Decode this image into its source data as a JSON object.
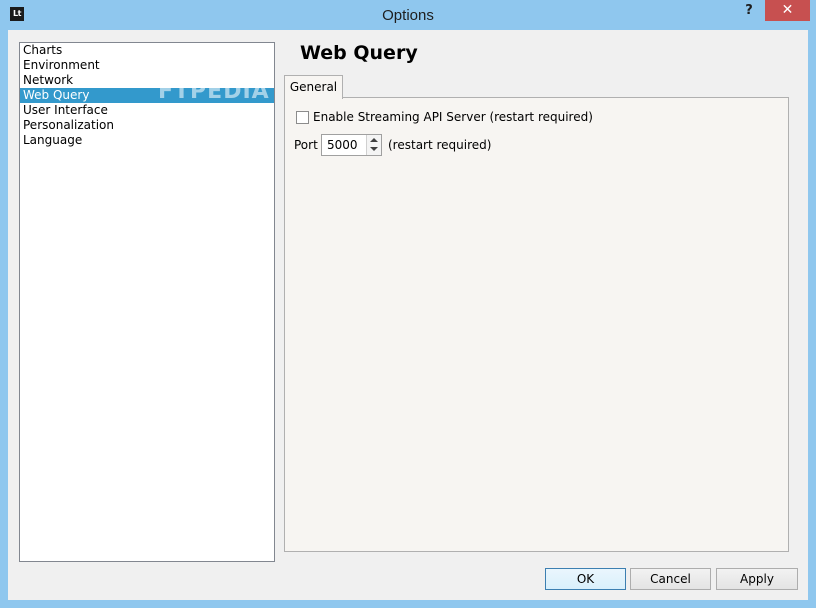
{
  "window": {
    "title": "Options",
    "app_icon_text": "Lt",
    "help_label": "?",
    "close_label": "✕"
  },
  "sidebar": {
    "items": [
      {
        "label": "Charts",
        "selected": false
      },
      {
        "label": "Environment",
        "selected": false
      },
      {
        "label": "Network",
        "selected": false
      },
      {
        "label": "Web Query",
        "selected": true
      },
      {
        "label": "User Interface",
        "selected": false
      },
      {
        "label": "Personalization",
        "selected": false
      },
      {
        "label": "Language",
        "selected": false
      }
    ],
    "watermark": "FTPEDIA"
  },
  "main": {
    "page_title": "Web Query",
    "tabs": [
      {
        "label": "General",
        "active": true
      }
    ],
    "streaming_checkbox": {
      "label": "Enable Streaming API Server (restart required)",
      "checked": false
    },
    "port": {
      "label": "Port",
      "value": "5000",
      "hint": "(restart required)"
    }
  },
  "footer": {
    "ok_label": "OK",
    "cancel_label": "Cancel",
    "apply_label": "Apply"
  },
  "colors": {
    "title_bar": "#8fc7ee",
    "close_button": "#c75050",
    "selection": "#3399cc",
    "dialog_background": "#f0f0f0"
  }
}
